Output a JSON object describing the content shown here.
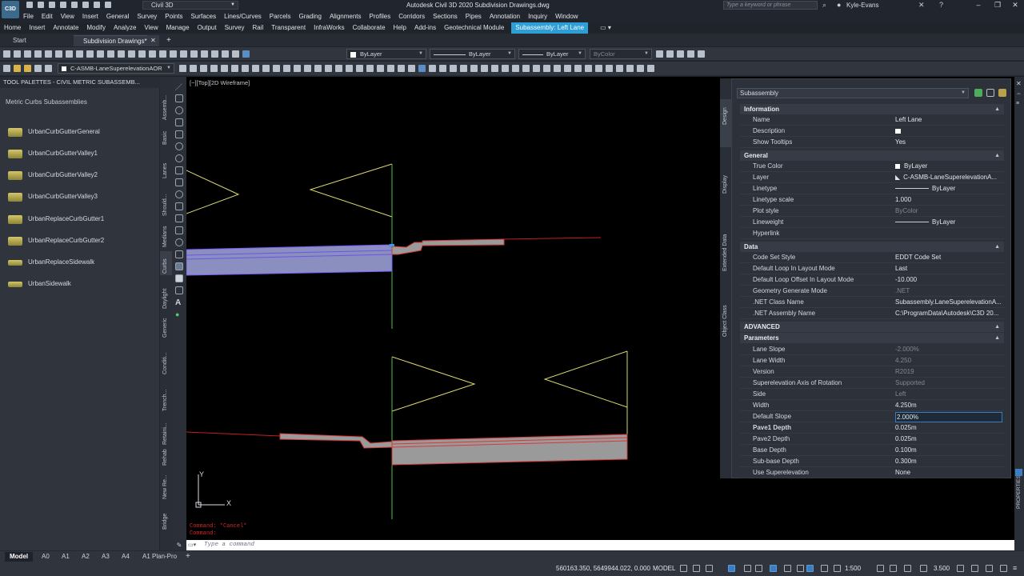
{
  "window": {
    "app_logo": "C3D",
    "workspace": "Civil 3D",
    "title": "Autodesk Civil 3D 2020    Subdivision Drawings.dwg",
    "search_placeholder": "Type a keyword or phrase",
    "user": "Kyle-Evans",
    "controls": [
      "minimize-icon",
      "restore-icon",
      "close-icon"
    ]
  },
  "menu": [
    "File",
    "Edit",
    "View",
    "Insert",
    "General",
    "Survey",
    "Points",
    "Surfaces",
    "Lines/Curves",
    "Parcels",
    "Grading",
    "Alignments",
    "Profiles",
    "Corridors",
    "Sections",
    "Pipes",
    "Annotation",
    "Inquiry",
    "Window"
  ],
  "ribbon_tabs": [
    "Home",
    "Insert",
    "Annotate",
    "Modify",
    "Analyze",
    "View",
    "Manage",
    "Output",
    "Survey",
    "Rail",
    "Transparent",
    "InfraWorks",
    "Collaborate",
    "Help",
    "Add-ins",
    "Geotechnical Module"
  ],
  "ribbon_context_tab": "Subassembly: Left Lane",
  "file_tabs": {
    "start": "Start",
    "drawing": "Subdivision Drawings*",
    "new_tab": "+"
  },
  "toolbar1": {
    "layer": "ByLayer",
    "linetype": "ByLayer",
    "lineweight": "ByLayer",
    "plotstyle": "ByColor"
  },
  "toolbar2": {
    "layer_name": "C-ASMB-LaneSuperelevationAOR"
  },
  "palette": {
    "title": "TOOL PALETTES - CIVIL METRIC SUBASSEMB...",
    "subtitle": "Metric Curbs Subassemblies",
    "items": [
      "UrbanCurbGutterGeneral",
      "UrbanCurbGutterValley1",
      "UrbanCurbGutterValley2",
      "UrbanCurbGutterValley3",
      "UrbanReplaceCurbGutter1",
      "UrbanReplaceCurbGutter2",
      "UrbanReplaceSidewalk",
      "UrbanSidewalk"
    ],
    "vertical_tabs": [
      "Assemb...",
      "Basic",
      "Lanes",
      "Should...",
      "Medians",
      "Curbs",
      "Daylight",
      "Generic",
      "Conditi...",
      "Trench...",
      "Retaini...",
      "Rehab",
      "New Re...",
      "Bridge"
    ]
  },
  "viewport": {
    "label": "[−][Top][2D Wireframe]",
    "ucs_x": "X",
    "ucs_y": "Y"
  },
  "properties": {
    "selector": "Subassembly",
    "side_tabs": [
      "Design",
      "Display",
      "Extended Data",
      "Object Class"
    ],
    "right_label": "PROPERTIES",
    "categories": {
      "information": "Information",
      "general": "General",
      "data": "Data",
      "advanced": "ADVANCED",
      "parameters": "Parameters"
    },
    "information": [
      {
        "k": "Name",
        "v": "Left Lane"
      },
      {
        "k": "Description",
        "v": ""
      },
      {
        "k": "Show Tooltips",
        "v": "Yes"
      }
    ],
    "general": [
      {
        "k": "True Color",
        "v": "ByLayer"
      },
      {
        "k": "Layer",
        "v": "C-ASMB-LaneSuperelevationA..."
      },
      {
        "k": "Linetype",
        "v": "ByLayer"
      },
      {
        "k": "Linetype scale",
        "v": "1.000"
      },
      {
        "k": "Plot style",
        "v": "ByColor"
      },
      {
        "k": "Lineweight",
        "v": "ByLayer"
      },
      {
        "k": "Hyperlink",
        "v": ""
      }
    ],
    "data": [
      {
        "k": "Code Set Style",
        "v": "EDDT Code Set"
      },
      {
        "k": "Default Loop In Layout Mode",
        "v": "Last"
      },
      {
        "k": "Default Loop Offset In Layout Mode",
        "v": "-10.000"
      },
      {
        "k": "Geometry Generate Mode",
        "v": ".NET"
      },
      {
        "k": ".NET Class Name",
        "v": "Subassembly.LaneSuperelevationA..."
      },
      {
        "k": ".NET Assembly Name",
        "v": "C:\\ProgramData\\Autodesk\\C3D 20..."
      }
    ],
    "parameters": [
      {
        "k": "Lane Slope",
        "v": "-2.000%"
      },
      {
        "k": "Lane Width",
        "v": "4.250"
      },
      {
        "k": "Version",
        "v": "R2019"
      },
      {
        "k": "Superelevation Axis of Rotation",
        "v": "Supported"
      },
      {
        "k": "Side",
        "v": "Left"
      },
      {
        "k": "Width",
        "v": "4.250m"
      },
      {
        "k": "Default Slope",
        "v": "2.000%"
      },
      {
        "k": "Pave1 Depth",
        "v": "0.025m"
      },
      {
        "k": "Pave2 Depth",
        "v": "0.025m"
      },
      {
        "k": "Base Depth",
        "v": "0.100m"
      },
      {
        "k": "Sub-base Depth",
        "v": "0.300m"
      },
      {
        "k": "Use Superelevation",
        "v": "None"
      }
    ]
  },
  "command": {
    "history1": "Command: *Cancel*",
    "history2": "Command:",
    "placeholder": "Type a command"
  },
  "layout_tabs": [
    "Model",
    "A0",
    "A1",
    "A2",
    "A3",
    "A4",
    "A1 Plan-Pro"
  ],
  "status": {
    "coordinates": "560163.350, 5649944.022, 0.000",
    "space": "MODEL",
    "scale": "1:500",
    "anno_value": "3.500"
  }
}
